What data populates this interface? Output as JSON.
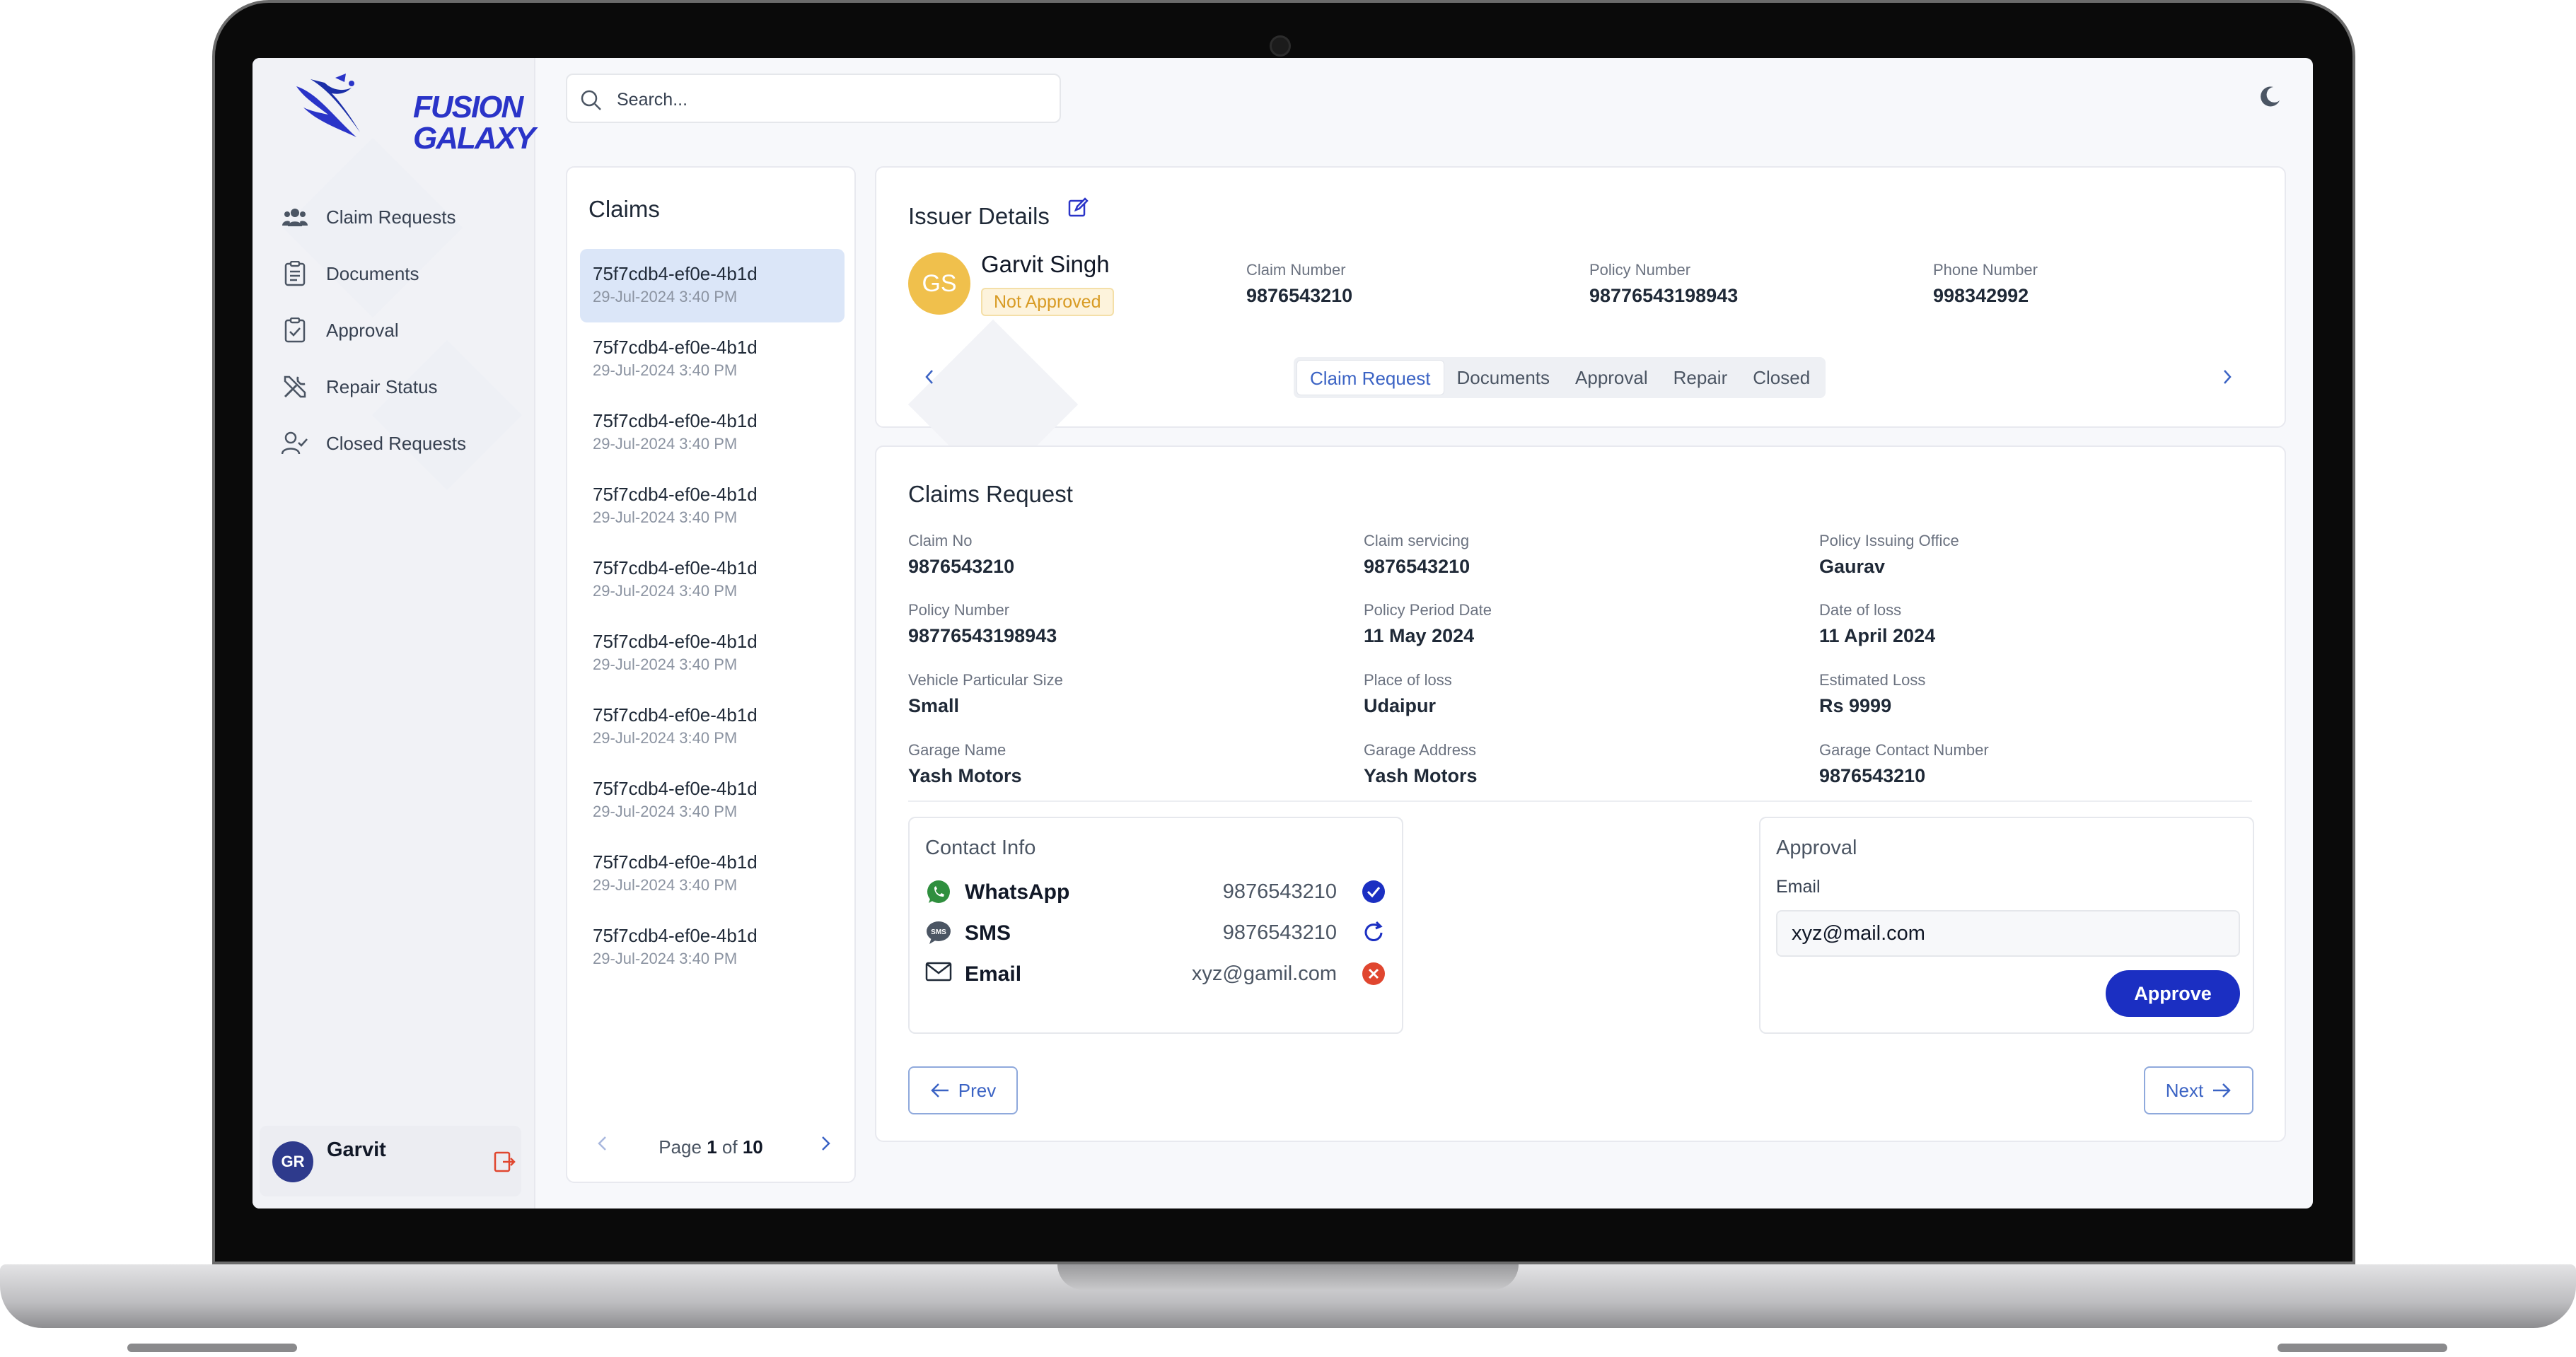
{
  "brand": {
    "line1": "FUSION",
    "line2": "GALAXY"
  },
  "search": {
    "placeholder": "Search..."
  },
  "sidebar": {
    "items": [
      {
        "label": "Claim Requests",
        "icon": "users-icon"
      },
      {
        "label": "Documents",
        "icon": "clipboard-list-icon"
      },
      {
        "label": "Approval",
        "icon": "clipboard-check-icon"
      },
      {
        "label": "Repair Status",
        "icon": "tools-icon"
      },
      {
        "label": "Closed Requests",
        "icon": "user-check-icon"
      }
    ],
    "user": {
      "initials": "GR",
      "name": "Garvit"
    }
  },
  "claims": {
    "title": "Claims",
    "items": [
      {
        "id": "75f7cdb4-ef0e-4b1d",
        "date": "29-Jul-2024 3:40 PM"
      },
      {
        "id": "75f7cdb4-ef0e-4b1d",
        "date": "29-Jul-2024 3:40 PM"
      },
      {
        "id": "75f7cdb4-ef0e-4b1d",
        "date": "29-Jul-2024 3:40 PM"
      },
      {
        "id": "75f7cdb4-ef0e-4b1d",
        "date": "29-Jul-2024 3:40 PM"
      },
      {
        "id": "75f7cdb4-ef0e-4b1d",
        "date": "29-Jul-2024 3:40 PM"
      },
      {
        "id": "75f7cdb4-ef0e-4b1d",
        "date": "29-Jul-2024 3:40 PM"
      },
      {
        "id": "75f7cdb4-ef0e-4b1d",
        "date": "29-Jul-2024 3:40 PM"
      },
      {
        "id": "75f7cdb4-ef0e-4b1d",
        "date": "29-Jul-2024 3:40 PM"
      },
      {
        "id": "75f7cdb4-ef0e-4b1d",
        "date": "29-Jul-2024 3:40 PM"
      },
      {
        "id": "75f7cdb4-ef0e-4b1d",
        "date": "29-Jul-2024 3:40 PM"
      }
    ],
    "pager": {
      "prefix": "Page",
      "current": "1",
      "of": "of",
      "total": "10"
    }
  },
  "issuer": {
    "title": "Issuer Details",
    "initials": "GS",
    "name": "Garvit Singh",
    "status": "Not Approved",
    "claim_number_label": "Claim Number",
    "claim_number": "9876543210",
    "policy_number_label": "Policy Number",
    "policy_number": "98776543198943",
    "phone_label": "Phone Number",
    "phone": "998342992",
    "tabs": [
      "Claim Request",
      "Documents",
      "Approval",
      "Repair",
      "Closed"
    ]
  },
  "request": {
    "title": "Claims Request",
    "fields": [
      {
        "label": "Claim No",
        "value": "9876543210"
      },
      {
        "label": "Claim servicing",
        "value": "9876543210"
      },
      {
        "label": "Policy Issuing Office",
        "value": "Gaurav"
      },
      {
        "label": "Policy Number",
        "value": "98776543198943"
      },
      {
        "label": "Policy Period Date",
        "value": "11 May 2024"
      },
      {
        "label": "Date of loss",
        "value": "11 April 2024"
      },
      {
        "label": "Vehicle Particular Size",
        "value": "Small"
      },
      {
        "label": "Place of loss",
        "value": " Udaipur"
      },
      {
        "label": "Estimated Loss",
        "value": " Rs 9999"
      },
      {
        "label": "Garage Name",
        "value": "Yash Motors"
      },
      {
        "label": "Garage Address",
        "value": "Yash Motors"
      },
      {
        "label": "Garage Contact Number",
        "value": "9876543210"
      }
    ]
  },
  "contact": {
    "title": "Contact Info",
    "rows": [
      {
        "label": "WhatsApp",
        "value": "9876543210",
        "status": "check-circle-icon"
      },
      {
        "label": "SMS",
        "value": "9876543210",
        "status": "refresh-icon"
      },
      {
        "label": "Email",
        "value": "xyz@gamil.com",
        "status": "x-circle-icon"
      }
    ]
  },
  "approval": {
    "title": "Approval",
    "email_label": "Email",
    "email_value": "xyz@mail.com",
    "button": "Approve"
  },
  "nav_buttons": {
    "prev": "Prev",
    "next": "Next"
  },
  "colors": {
    "primary": "#1b2fc2",
    "accent": "#3b63c4",
    "warning": "#d89b24",
    "selected": "#dbe6f8"
  }
}
